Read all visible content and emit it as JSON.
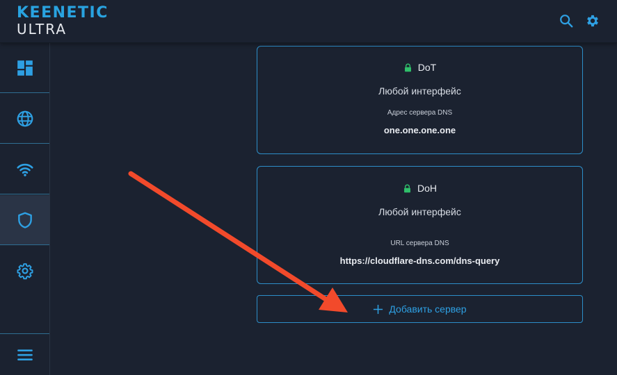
{
  "app": {
    "logo_line1": "KEENETIC",
    "logo_line2": "ULTRA"
  },
  "header": {
    "icons": [
      "search-icon",
      "gear-icon"
    ]
  },
  "sidebar": {
    "items": [
      {
        "icon": "dashboard-icon",
        "active": false
      },
      {
        "icon": "globe-icon",
        "active": false
      },
      {
        "icon": "wifi-icon",
        "active": false
      },
      {
        "icon": "shield-icon",
        "active": true
      },
      {
        "icon": "gear-icon",
        "active": false
      }
    ],
    "bottom_icon": "menu-icon"
  },
  "servers": [
    {
      "protocol": "DoT",
      "interface": "Любой интерфейс",
      "address_label": "Адрес сервера DNS",
      "address_value": "one.one.one.one"
    },
    {
      "protocol": "DoH",
      "interface": "Любой интерфейс",
      "address_label": "URL сервера DNS",
      "address_value": "https://cloudflare-dns.com/dns-query"
    }
  ],
  "add_server": {
    "label": "Добавить сервер"
  },
  "colors": {
    "accent": "#2ea0e3",
    "lock": "#2fbf6a",
    "annotation_arrow": "#f24a2b",
    "background": "#1b2230"
  }
}
